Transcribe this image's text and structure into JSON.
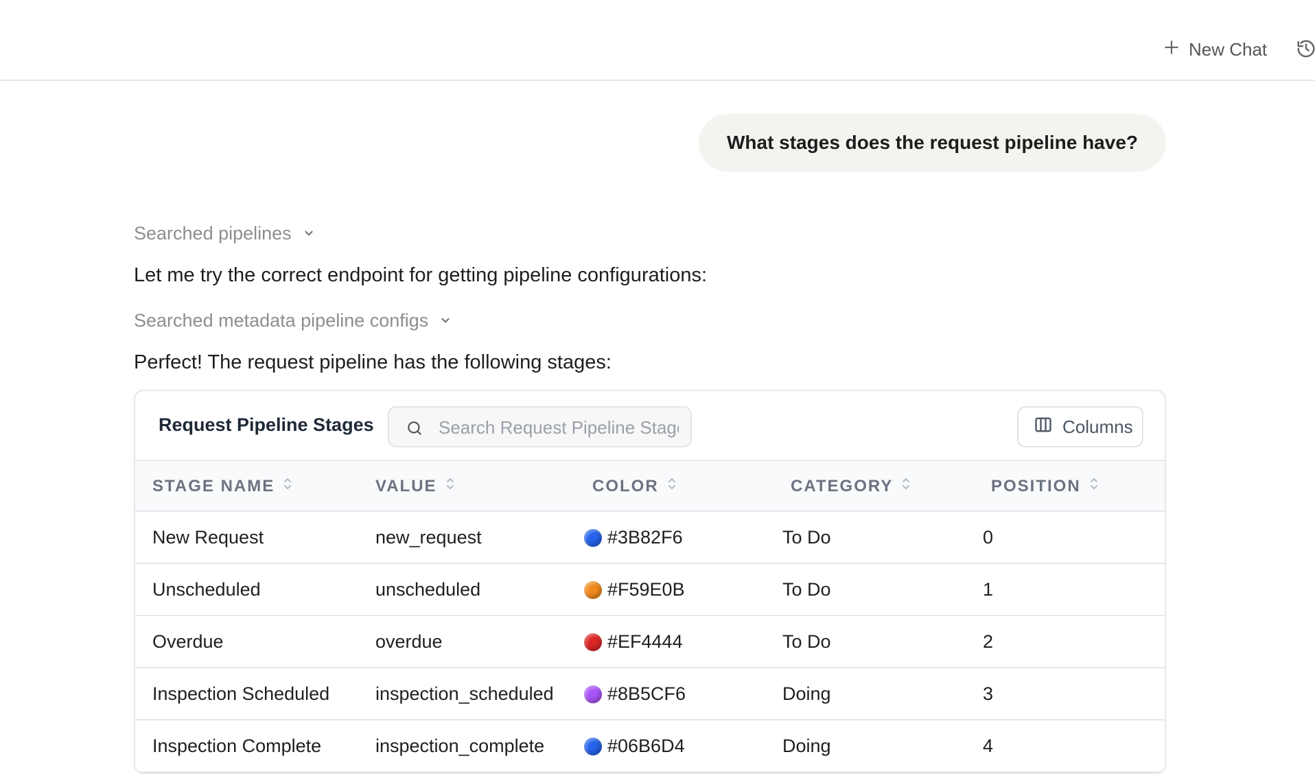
{
  "header": {
    "new_chat_label": "New Chat",
    "new_chat_icon": "plus-icon",
    "history_icon": "history-icon"
  },
  "conversation": {
    "user_message": "What stages does the request pipeline have?",
    "tool_call_1": "Searched pipelines",
    "assistant_text_1": "Let me try the correct endpoint for getting pipeline configurations:",
    "tool_call_2": "Searched metadata pipeline configs",
    "assistant_text_2": "Perfect! The request pipeline has the following stages:"
  },
  "table": {
    "title": "Request Pipeline Stages",
    "search_placeholder": "Search Request Pipeline Stages...",
    "columns_button": "Columns",
    "headers": [
      "STAGE NAME",
      "VALUE",
      "COLOR",
      "CATEGORY",
      "POSITION"
    ],
    "rows": [
      {
        "name": "New Request",
        "value": "new_request",
        "color": "#3B82F6",
        "dot": "#2563eb",
        "category": "To Do",
        "position": "0"
      },
      {
        "name": "Unscheduled",
        "value": "unscheduled",
        "color": "#F59E0B",
        "dot": "#f08a1c",
        "category": "To Do",
        "position": "1"
      },
      {
        "name": "Overdue",
        "value": "overdue",
        "color": "#EF4444",
        "dot": "#dc2626",
        "category": "To Do",
        "position": "2"
      },
      {
        "name": "Inspection Scheduled",
        "value": "inspection_scheduled",
        "color": "#8B5CF6",
        "dot": "#a855f7",
        "category": "Doing",
        "position": "3"
      },
      {
        "name": "Inspection Complete",
        "value": "inspection_complete",
        "color": "#06B6D4",
        "dot": "#2563eb",
        "category": "Doing",
        "position": "4"
      }
    ]
  }
}
